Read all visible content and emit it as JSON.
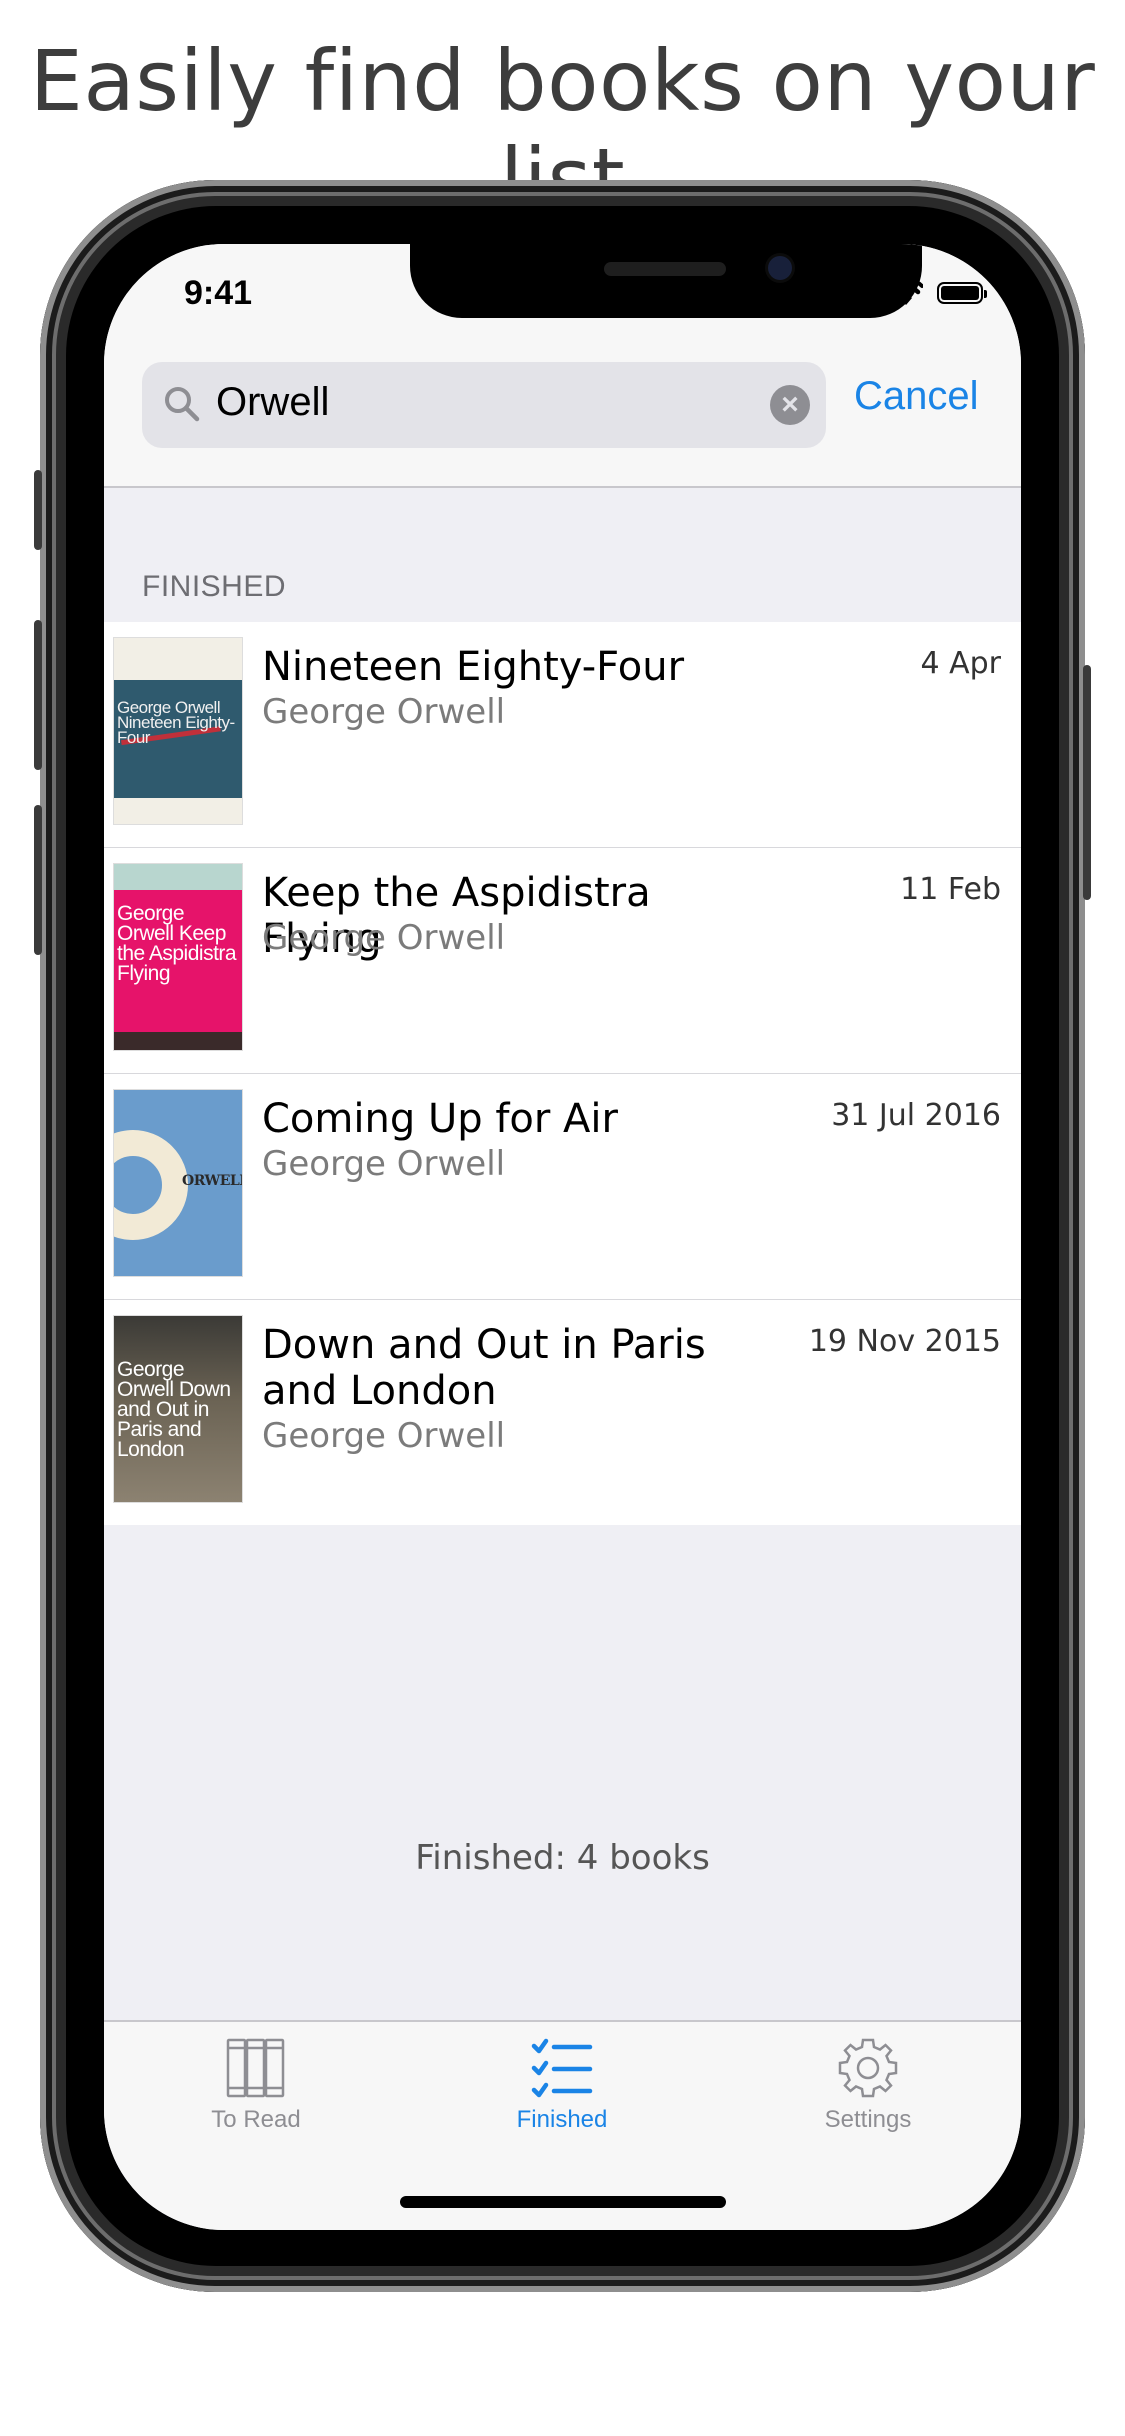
{
  "headline": "Easily find books on your list",
  "status_bar": {
    "time": "9:41"
  },
  "search": {
    "query": "Orwell",
    "cancel_label": "Cancel"
  },
  "section": {
    "header": "FINISHED"
  },
  "books": [
    {
      "title": "Nineteen Eighty-Four",
      "author": "George Orwell",
      "date": "4 Apr",
      "cover_text": "George Orwell Nineteen Eighty-Four"
    },
    {
      "title": "Keep the Aspidistra Flying",
      "author": "George Orwell",
      "date": "11 Feb",
      "cover_text": "George Orwell Keep the Aspidistra Flying"
    },
    {
      "title": "Coming Up for Air",
      "author": "George Orwell",
      "date": "31 Jul 2016",
      "cover_text": "ORWELL"
    },
    {
      "title": "Down and Out in Paris and London",
      "author": "George Orwell",
      "date": "19 Nov 2015",
      "cover_text": "George Orwell Down and Out in Paris and London"
    }
  ],
  "footer": {
    "count_text": "Finished: 4 books"
  },
  "tabs": [
    {
      "label": "To Read",
      "icon": "books-icon",
      "selected": false
    },
    {
      "label": "Finished",
      "icon": "checklist-icon",
      "selected": true
    },
    {
      "label": "Settings",
      "icon": "gear-icon",
      "selected": false
    }
  ],
  "colors": {
    "accent": "#1a84e6",
    "tab_inactive": "#8e8e93",
    "background": "#efeff4"
  }
}
